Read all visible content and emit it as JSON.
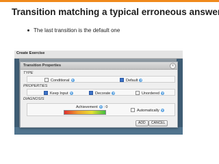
{
  "slide": {
    "title": "Transition matching a typical erroneous answer",
    "bullet": "The last transition is the default one"
  },
  "app": {
    "window_title": "Create Exercise",
    "dialog": {
      "title": "Transition Properties",
      "sections": {
        "type": {
          "label": "TYPE",
          "options": [
            {
              "label": "Conditional",
              "checked": false
            },
            {
              "label": "Default",
              "checked": true
            }
          ]
        },
        "properties": {
          "label": "PROPERTIES",
          "options": [
            {
              "label": "Keep Input",
              "checked": true
            },
            {
              "label": "Decorate",
              "checked": true
            },
            {
              "label": "Unordered",
              "checked": false
            }
          ]
        },
        "diagnosis": {
          "label": "DIAGNOSIS",
          "achievement_label": "Achievement",
          "achievement_value": ": 0",
          "automatically": {
            "label": "Automatically",
            "checked": false
          }
        }
      },
      "buttons": {
        "add": "ADD",
        "cancel": "CANCEL"
      }
    }
  },
  "colors": {
    "accent": "#f08a1c",
    "checkbox_checked": "#3e74c9",
    "help_icon": "#57a0e0",
    "background_blue": "#3f5d74"
  },
  "icons": {
    "help": "question-mark-icon",
    "close": "close-icon"
  }
}
